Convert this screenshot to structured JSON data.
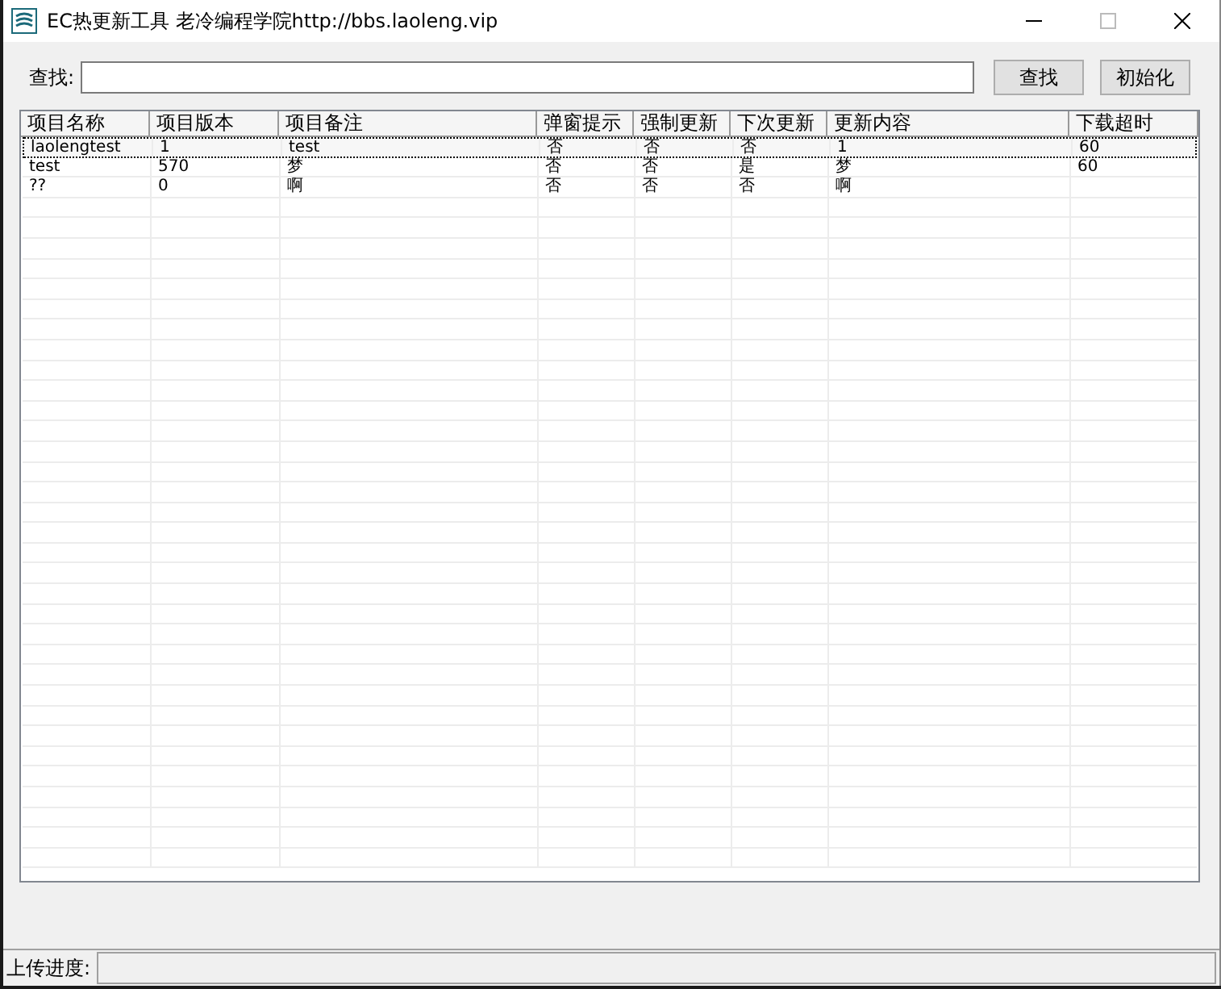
{
  "window": {
    "title": "EC热更新工具 老冷编程学院http://bbs.laoleng.vip"
  },
  "search": {
    "label": "查找:"
  },
  "buttons": [
    {
      "label": "查找"
    },
    {
      "label": "初始化"
    }
  ],
  "table": {
    "columns": [
      "项目名称",
      "项目版本",
      "项目备注",
      "弹窗提示",
      "强制更新",
      "下次更新",
      "更新内容",
      "下载超时"
    ],
    "rows": [
      {
        "selected": true,
        "cells": [
          "laolengtest",
          "1",
          "test",
          "否",
          "否",
          "否",
          "1",
          "60"
        ]
      },
      {
        "selected": false,
        "cells": [
          "test",
          "570",
          "梦",
          "否",
          "否",
          "是",
          "梦",
          "60"
        ]
      },
      {
        "selected": false,
        "cells": [
          "??",
          "0",
          "啊",
          "否",
          "否",
          "否",
          "啊",
          ""
        ]
      }
    ]
  },
  "status_bar": {
    "label": "上传进度:",
    "level": 0
  }
}
